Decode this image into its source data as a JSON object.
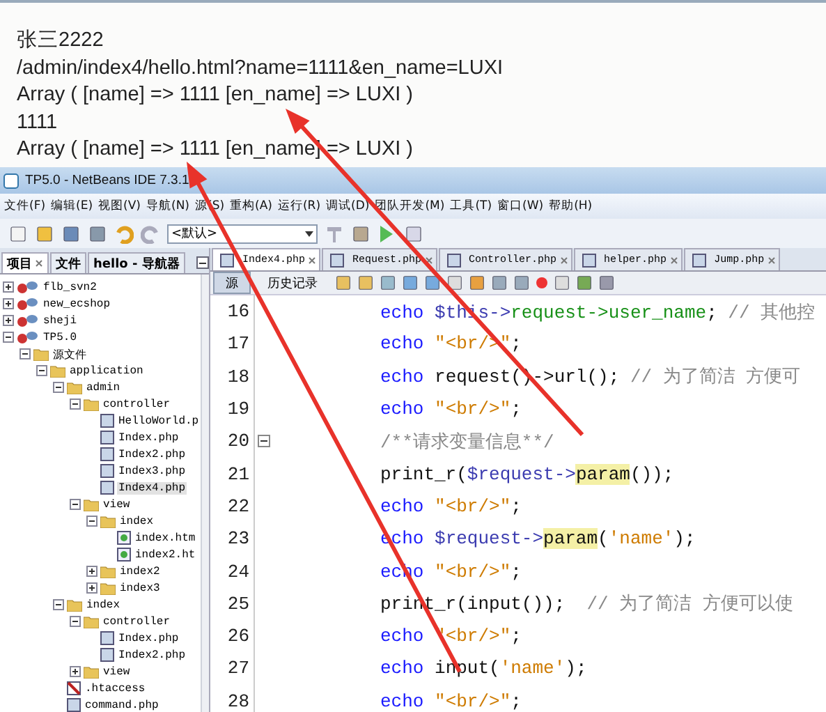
{
  "browser_output": {
    "lines": [
      "张三2222",
      "/admin/index4/hello.html?name=1111&en_name=LUXI",
      "Array ( [name] => 1111 [en_name] => LUXI )",
      "1111",
      "Array ( [name] => 1111 [en_name] => LUXI )"
    ]
  },
  "window": {
    "title": "TP5.0 - NetBeans IDE 7.3.1"
  },
  "menu": [
    "文件(F)",
    "编辑(E)",
    "视图(V)",
    "导航(N)",
    "源(S)",
    "重构(A)",
    "运行(R)",
    "调试(D)",
    "团队开发(M)",
    "工具(T)",
    "窗口(W)",
    "帮助(H)"
  ],
  "toolbar": {
    "config_dropdown": "<默认>"
  },
  "side_tabs": [
    {
      "label": "项目",
      "selected": true
    },
    {
      "label": "文件",
      "selected": false
    },
    {
      "label": "hello - 导航器",
      "selected": false
    }
  ],
  "tree": [
    {
      "label": "flb_svn2",
      "kind": "project",
      "expanded": false,
      "selected": false
    },
    {
      "label": "new_ecshop",
      "kind": "project",
      "expanded": false,
      "selected": false
    },
    {
      "label": "sheji",
      "kind": "project",
      "expanded": false,
      "selected": false
    },
    {
      "label": "TP5.0",
      "kind": "project",
      "expanded": true,
      "selected": false,
      "children": [
        {
          "label": "源文件",
          "kind": "folder",
          "expanded": true,
          "selected": false,
          "children": [
            {
              "label": "application",
              "kind": "folder",
              "expanded": true,
              "selected": false,
              "children": [
                {
                  "label": "admin",
                  "kind": "folder",
                  "expanded": true,
                  "selected": false,
                  "children": [
                    {
                      "label": "controller",
                      "kind": "folder",
                      "expanded": true,
                      "selected": false,
                      "children": [
                        {
                          "label": "HelloWorld.p",
                          "kind": "php",
                          "selected": false
                        },
                        {
                          "label": "Index.php",
                          "kind": "php",
                          "selected": false
                        },
                        {
                          "label": "Index2.php",
                          "kind": "php",
                          "selected": false
                        },
                        {
                          "label": "Index3.php",
                          "kind": "php",
                          "selected": false
                        },
                        {
                          "label": "Index4.php",
                          "kind": "php",
                          "selected": true
                        }
                      ]
                    },
                    {
                      "label": "view",
                      "kind": "folder",
                      "expanded": true,
                      "selected": false,
                      "children": [
                        {
                          "label": "index",
                          "kind": "folder",
                          "expanded": true,
                          "selected": false,
                          "children": [
                            {
                              "label": "index.htm",
                              "kind": "html",
                              "selected": false
                            },
                            {
                              "label": "index2.ht",
                              "kind": "html",
                              "selected": false
                            }
                          ]
                        },
                        {
                          "label": "index2",
                          "kind": "folder",
                          "expanded": false,
                          "selected": false
                        },
                        {
                          "label": "index3",
                          "kind": "folder",
                          "expanded": false,
                          "selected": false
                        }
                      ]
                    }
                  ]
                },
                {
                  "label": "index",
                  "kind": "folder",
                  "expanded": true,
                  "selected": false,
                  "children": [
                    {
                      "label": "controller",
                      "kind": "folder",
                      "expanded": true,
                      "selected": false,
                      "children": [
                        {
                          "label": "Index.php",
                          "kind": "php",
                          "selected": false
                        },
                        {
                          "label": "Index2.php",
                          "kind": "php",
                          "selected": false
                        }
                      ]
                    },
                    {
                      "label": "view",
                      "kind": "folder",
                      "expanded": false,
                      "selected": false
                    }
                  ]
                },
                {
                  "label": ".htaccess",
                  "kind": "config",
                  "selected": false
                },
                {
                  "label": "command.php",
                  "kind": "php",
                  "selected": false
                }
              ]
            }
          ]
        }
      ]
    }
  ],
  "editor_tabs": [
    {
      "label": "Index4.php",
      "selected": true
    },
    {
      "label": "Request.php",
      "selected": false
    },
    {
      "label": "Controller.php",
      "selected": false
    },
    {
      "label": "helper.php",
      "selected": false
    },
    {
      "label": "Jump.php",
      "selected": false
    }
  ],
  "editor_modes": [
    {
      "label": "源",
      "selected": true
    },
    {
      "label": "历史记录",
      "selected": false
    }
  ],
  "code": [
    {
      "number": "16",
      "tokens": [
        {
          "text": "echo ",
          "kind": "keyword"
        },
        {
          "text": "$this->",
          "kind": "variable"
        },
        {
          "text": "request->user_name",
          "kind": "member"
        },
        {
          "text": "; ",
          "kind": "plain"
        },
        {
          "text": "// 其他控",
          "kind": "comment"
        }
      ]
    },
    {
      "number": "17",
      "tokens": [
        {
          "text": "echo ",
          "kind": "keyword"
        },
        {
          "text": "\"<br/>\"",
          "kind": "string"
        },
        {
          "text": ";",
          "kind": "plain"
        }
      ]
    },
    {
      "number": "18",
      "tokens": [
        {
          "text": "echo ",
          "kind": "keyword"
        },
        {
          "text": "request()->url(); ",
          "kind": "plain"
        },
        {
          "text": "// 为了简洁 方便可",
          "kind": "comment"
        }
      ]
    },
    {
      "number": "19",
      "tokens": [
        {
          "text": "echo ",
          "kind": "keyword"
        },
        {
          "text": "\"<br/>\"",
          "kind": "string"
        },
        {
          "text": ";",
          "kind": "plain"
        }
      ]
    },
    {
      "number": "20",
      "fold": true,
      "tokens": [
        {
          "text": "/**请求变量信息**/",
          "kind": "comment"
        }
      ]
    },
    {
      "number": "21",
      "tokens": [
        {
          "text": "print_r(",
          "kind": "plain"
        },
        {
          "text": "$request->",
          "kind": "variable"
        },
        {
          "text": "param",
          "kind": "highlight"
        },
        {
          "text": "());",
          "kind": "plain"
        }
      ]
    },
    {
      "number": "22",
      "tokens": [
        {
          "text": "echo ",
          "kind": "keyword"
        },
        {
          "text": "\"<br/>\"",
          "kind": "string"
        },
        {
          "text": ";",
          "kind": "plain"
        }
      ]
    },
    {
      "number": "23",
      "tokens": [
        {
          "text": "echo ",
          "kind": "keyword"
        },
        {
          "text": "$request->",
          "kind": "variable"
        },
        {
          "text": "param",
          "kind": "highlight"
        },
        {
          "text": "(",
          "kind": "plain"
        },
        {
          "text": "'name'",
          "kind": "string"
        },
        {
          "text": ");",
          "kind": "plain"
        }
      ]
    },
    {
      "number": "24",
      "tokens": [
        {
          "text": "echo ",
          "kind": "keyword"
        },
        {
          "text": "\"<br/>\"",
          "kind": "string"
        },
        {
          "text": ";",
          "kind": "plain"
        }
      ]
    },
    {
      "number": "25",
      "tokens": [
        {
          "text": "print_r(input());  ",
          "kind": "plain"
        },
        {
          "text": "// 为了简洁 方便可以使",
          "kind": "comment"
        }
      ]
    },
    {
      "number": "26",
      "tokens": [
        {
          "text": "echo ",
          "kind": "keyword"
        },
        {
          "text": "\"<br/>\"",
          "kind": "string"
        },
        {
          "text": ";",
          "kind": "plain"
        }
      ]
    },
    {
      "number": "27",
      "tokens": [
        {
          "text": "echo ",
          "kind": "keyword"
        },
        {
          "text": "input(",
          "kind": "plain"
        },
        {
          "text": "'name'",
          "kind": "string"
        },
        {
          "text": ");",
          "kind": "plain"
        }
      ]
    },
    {
      "number": "28",
      "tokens": [
        {
          "text": "echo ",
          "kind": "keyword"
        },
        {
          "text": "\"<br/>\"",
          "kind": "string"
        },
        {
          "text": ";",
          "kind": "plain"
        }
      ]
    }
  ]
}
